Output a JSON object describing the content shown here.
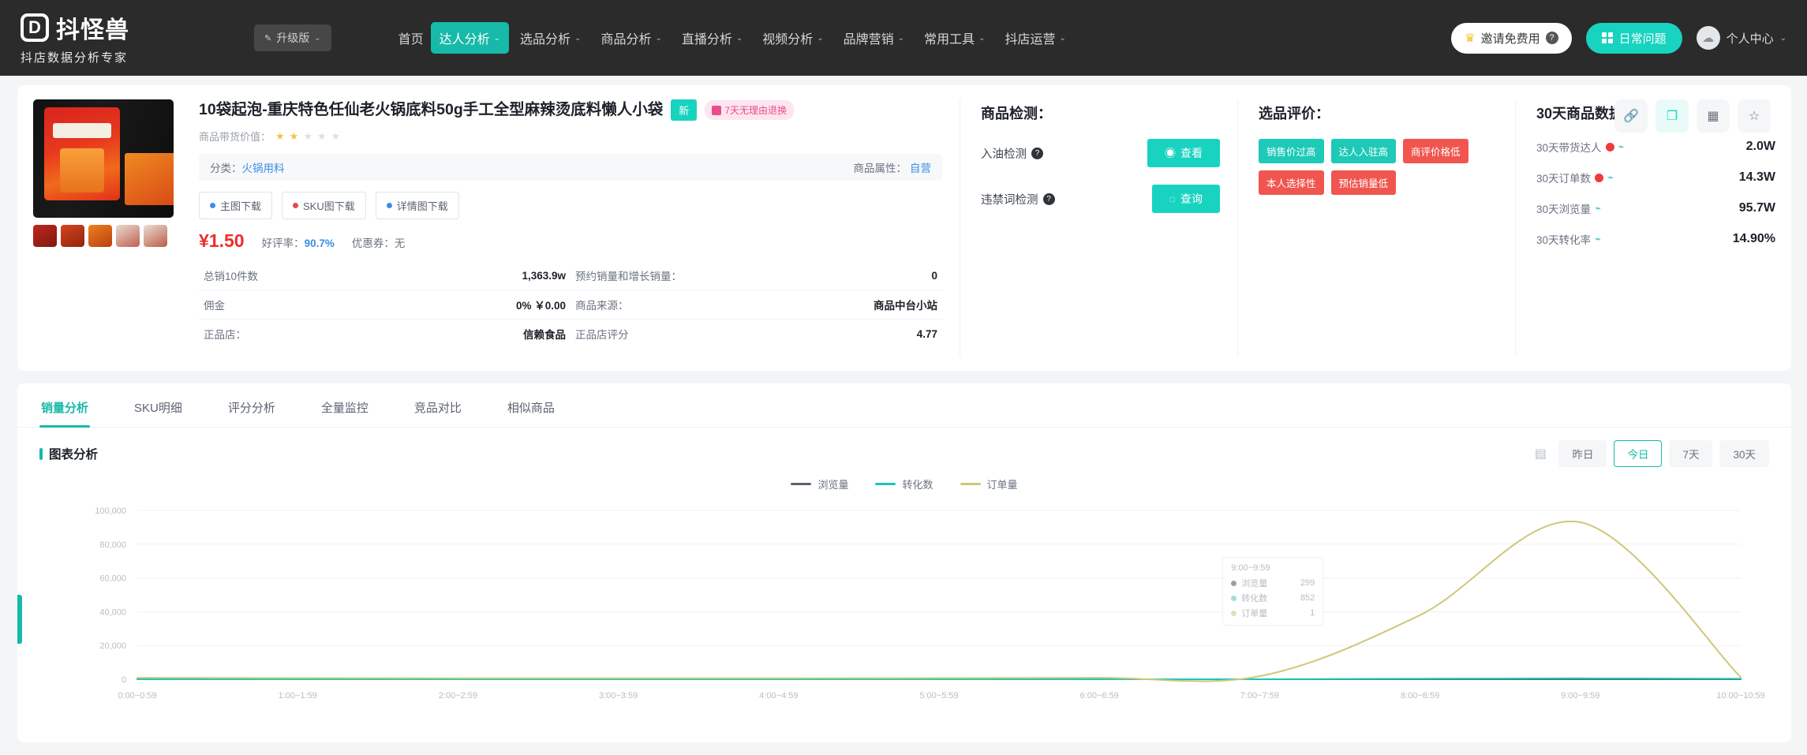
{
  "header": {
    "logo_text": "抖怪兽",
    "logo_mark": "D",
    "logo_sub": "抖店数据分析专家",
    "version_label": "升级版",
    "version_edit_icon": "pencil-icon",
    "nav": [
      {
        "label": "首页",
        "caret": ""
      },
      {
        "label": "达人分析",
        "caret": "⌄"
      },
      {
        "label": "选品分析",
        "caret": "⌄"
      },
      {
        "label": "商品分析",
        "caret": "⌄"
      },
      {
        "label": "直播分析",
        "caret": "⌄"
      },
      {
        "label": "视频分析",
        "caret": "⌄"
      },
      {
        "label": "品牌营销",
        "caret": "⌄"
      },
      {
        "label": "常用工具",
        "caret": "⌄"
      },
      {
        "label": "抖店运营",
        "caret": "⌄"
      }
    ],
    "trial_button": "邀请免费用",
    "trial_icon": "crown-icon",
    "trial_help": "?",
    "app_button": "日常问题",
    "app_icon": "grid-icon",
    "user_label": "个人中心",
    "user_caret": "⌄",
    "user_icon": "avatar-icon"
  },
  "product": {
    "title": "10袋起泡-重庆特色任仙老火锅底料50g手工全型麻辣烫底料懒人小袋",
    "badge_teal": "新",
    "badge_pink": "7天无理由退换",
    "rating_label": "商品带货价值：",
    "stars_filled": 2,
    "stars_total": 5,
    "category_label": "分类：",
    "category_value": "火锅用料",
    "attr_label": "商品属性：",
    "attr_value": "自营",
    "downloads": [
      {
        "label": "主图下载",
        "color": "blue"
      },
      {
        "label": "SKU图下载",
        "color": "red"
      },
      {
        "label": "详情图下载",
        "color": "blue"
      }
    ],
    "price": "¥1.50",
    "good_rate_label": "好评率：",
    "good_rate_value": "90.7%",
    "coupon_label": "优惠券：",
    "coupon_value": "无",
    "rows": [
      {
        "k": "总销10件数",
        "v": "1,363.9w",
        "k2": "预约销量和增长销量：",
        "v2": "0"
      },
      {
        "k": "佣金",
        "v": "0%  ￥0.00",
        "k2": "商品来源：",
        "v2": "商品中台小站"
      },
      {
        "k": "正品店：",
        "v": "信赖食品",
        "k2": "正品店评分",
        "v2": "4.77"
      }
    ],
    "actions": [
      {
        "icon": "link-icon",
        "name": "copy-link-button"
      },
      {
        "icon": "copy-icon",
        "name": "copy-button"
      },
      {
        "icon": "qrcode-icon",
        "name": "qrcode-button"
      },
      {
        "icon": "star-icon",
        "name": "favorite-button"
      }
    ]
  },
  "detection": {
    "title": "商品检测：",
    "items": [
      {
        "label": "入油检测",
        "help": "?",
        "button": "查看",
        "button_icon": "eye-icon"
      },
      {
        "label": "违禁词检测",
        "help": "?",
        "button": "查询",
        "button_icon": "search-icon"
      }
    ]
  },
  "evaluation": {
    "title": "选品评价：",
    "tags": [
      {
        "label": "销售价过高",
        "color": "teal"
      },
      {
        "label": "达人入驻高",
        "color": "teal"
      },
      {
        "label": "商评价格低",
        "color": "red"
      },
      {
        "label": "本人选择性",
        "color": "red"
      },
      {
        "label": "预估销量低",
        "color": "red"
      }
    ]
  },
  "stats30": {
    "title": "30天商品数据",
    "rows": [
      {
        "label": "30天带货达人",
        "hot": true,
        "value": "2.0W"
      },
      {
        "label": "30天订单数",
        "hot": true,
        "value": "14.3W"
      },
      {
        "label": "30天浏览量",
        "hot": false,
        "value": "95.7W"
      },
      {
        "label": "30天转化率",
        "hot": false,
        "value": "14.90%"
      }
    ]
  },
  "tabs": [
    {
      "label": "销量分析",
      "active": true
    },
    {
      "label": "SKU明细",
      "active": false
    },
    {
      "label": "评分分析",
      "active": false
    },
    {
      "label": "全量监控",
      "active": false
    },
    {
      "label": "竞品对比",
      "active": false
    },
    {
      "label": "相似商品",
      "active": false
    }
  ],
  "chart_panel": {
    "title": "图表分析",
    "calendar_icon": "calendar-icon",
    "ranges": [
      {
        "label": "昨日",
        "active": false
      },
      {
        "label": "今日",
        "active": true
      },
      {
        "label": "7天",
        "active": false
      },
      {
        "label": "30天",
        "active": false
      }
    ],
    "tooltip": {
      "header": "9:00~9:59",
      "rows": [
        {
          "name": "浏览量",
          "value": "299",
          "color": "#5b6270"
        },
        {
          "name": "转化数",
          "value": "852",
          "color": "#17c8b6"
        },
        {
          "name": "订单量",
          "value": "1",
          "color": "#cfc77a"
        }
      ]
    }
  },
  "chart_data": {
    "type": "line",
    "title": "图表分析",
    "xlabel": "",
    "ylabel": "",
    "ylim": [
      0,
      100000
    ],
    "yticks": [
      0,
      20000,
      40000,
      60000,
      80000,
      100000
    ],
    "ytick_labels": [
      "0",
      "20,000",
      "40,000",
      "60,000",
      "80,000",
      "100,000"
    ],
    "grid": true,
    "legend_position": "top-center",
    "categories": [
      "0:00~0:59",
      "1:00~1:59",
      "2:00~2:59",
      "3:00~3:59",
      "4:00~4:59",
      "5:00~5:59",
      "6:00~6:59",
      "7:00~7:59",
      "8:00~8:59",
      "9:00~9:59",
      "10:00~10:59"
    ],
    "series": [
      {
        "name": "浏览量",
        "color": "#5b6270",
        "values": [
          0,
          0,
          0,
          0,
          0,
          0,
          0,
          0,
          0,
          0,
          0
        ]
      },
      {
        "name": "转化数",
        "color": "#17c8b6",
        "values": [
          0,
          0,
          0,
          0,
          0,
          0,
          0,
          0,
          300,
          500,
          300
        ]
      },
      {
        "name": "订单量",
        "color": "#cfc77a",
        "values": [
          900,
          700,
          600,
          600,
          600,
          700,
          900,
          1800,
          38000,
          93000,
          1200
        ]
      }
    ]
  }
}
